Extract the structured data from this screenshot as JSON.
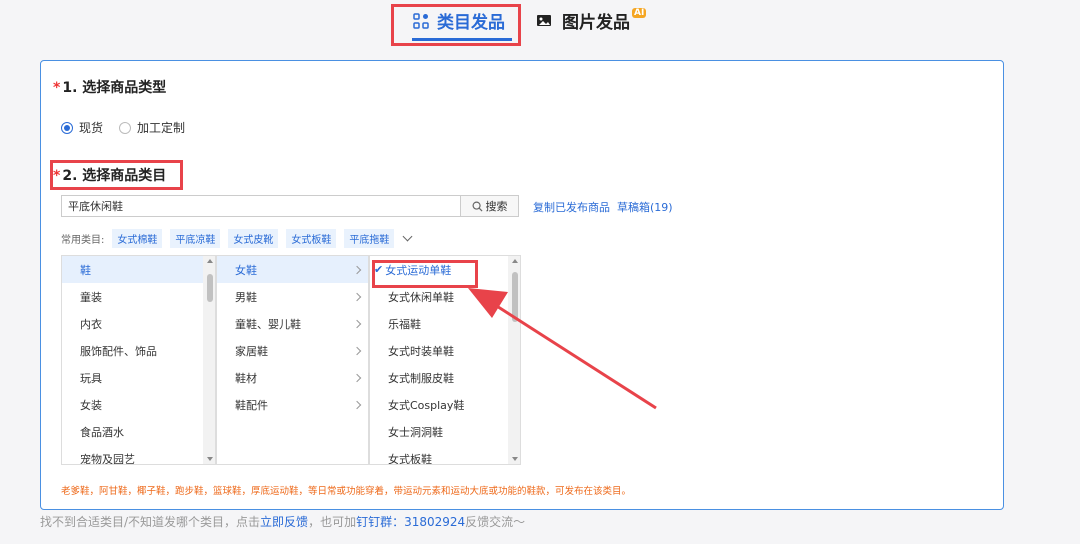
{
  "tabs": {
    "category": "类目发品",
    "image": "图片发品",
    "ai_badge": "AI"
  },
  "section1": {
    "title": "1. 选择商品类型",
    "options": [
      "现货",
      "加工定制"
    ],
    "selected": "现货"
  },
  "section2": {
    "title": "2. 选择商品类目",
    "search_value": "平底休闲鞋",
    "search_button": "搜索",
    "copy_link": "复制已发布商品",
    "draft_link": "草稿箱(19)"
  },
  "common": {
    "label": "常用类目:",
    "chips": [
      "女式棉鞋",
      "平底凉鞋",
      "女式皮靴",
      "女式板鞋",
      "平底拖鞋"
    ]
  },
  "columns": {
    "col1": [
      "鞋",
      "童装",
      "内衣",
      "服饰配件、饰品",
      "玩具",
      "女装",
      "食品酒水",
      "宠物及园艺"
    ],
    "col2": [
      "女鞋",
      "男鞋",
      "童鞋、婴儿鞋",
      "家居鞋",
      "鞋材",
      "鞋配件"
    ],
    "col3": [
      "女式运动单鞋",
      "女式休闲单鞋",
      "乐福鞋",
      "女式时装单鞋",
      "女式制服皮鞋",
      "女式Cosplay鞋",
      "女士洞洞鞋",
      "女式板鞋"
    ]
  },
  "note": "老爹鞋，阿甘鞋，椰子鞋，跑步鞋，篮球鞋，厚底运动鞋，等日常或功能穿着，带运动元素和运动大底或功能的鞋款，可发布在该类目。",
  "footer": {
    "prefix": "找不到合适类目/不知道发哪个类目，点击",
    "feedback": "立即反馈",
    "middle": "，也可加",
    "dingding": "钉钉群：31802924",
    "suffix": "反馈交流～"
  },
  "colors": {
    "accent": "#2a6bd6",
    "highlight": "#e8434a",
    "note": "#ee6a1b"
  }
}
